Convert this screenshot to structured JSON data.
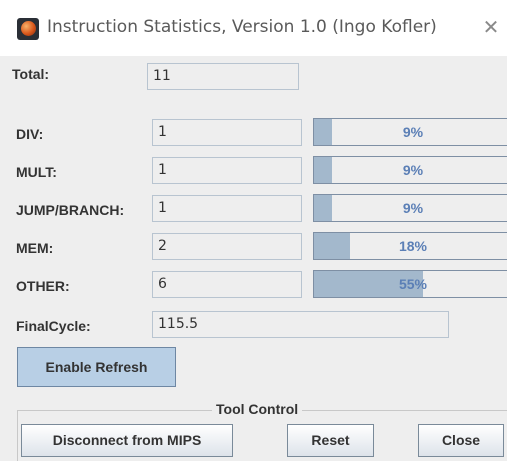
{
  "window": {
    "title": "Instruction Statistics, Version 1.0 (Ingo Kofler)",
    "icon": "mars-planet-icon",
    "close_glyph": "✕"
  },
  "total": {
    "label": "Total:",
    "value": "11"
  },
  "rows": [
    {
      "label": "DIV:",
      "value": "1",
      "percent_text": "9%",
      "fraction": 0.09
    },
    {
      "label": "MULT:",
      "value": "1",
      "percent_text": "9%",
      "fraction": 0.09
    },
    {
      "label": "JUMP/BRANCH:",
      "value": "1",
      "percent_text": "9%",
      "fraction": 0.09
    },
    {
      "label": "MEM:",
      "value": "2",
      "percent_text": "18%",
      "fraction": 0.18
    },
    {
      "label": "OTHER:",
      "value": "6",
      "percent_text": "55%",
      "fraction": 0.55
    }
  ],
  "final_cycle": {
    "label": "FinalCycle:",
    "value": "115.5"
  },
  "buttons": {
    "enable_refresh": "Enable Refresh",
    "disconnect": "Disconnect from MIPS",
    "reset": "Reset",
    "close": "Close"
  },
  "tool_control": {
    "caption": "Tool Control"
  },
  "colors": {
    "bar_fill": "#a3b8cc",
    "bar_text": "#5b7fb6",
    "refresh_button": "#b8cfe5"
  }
}
